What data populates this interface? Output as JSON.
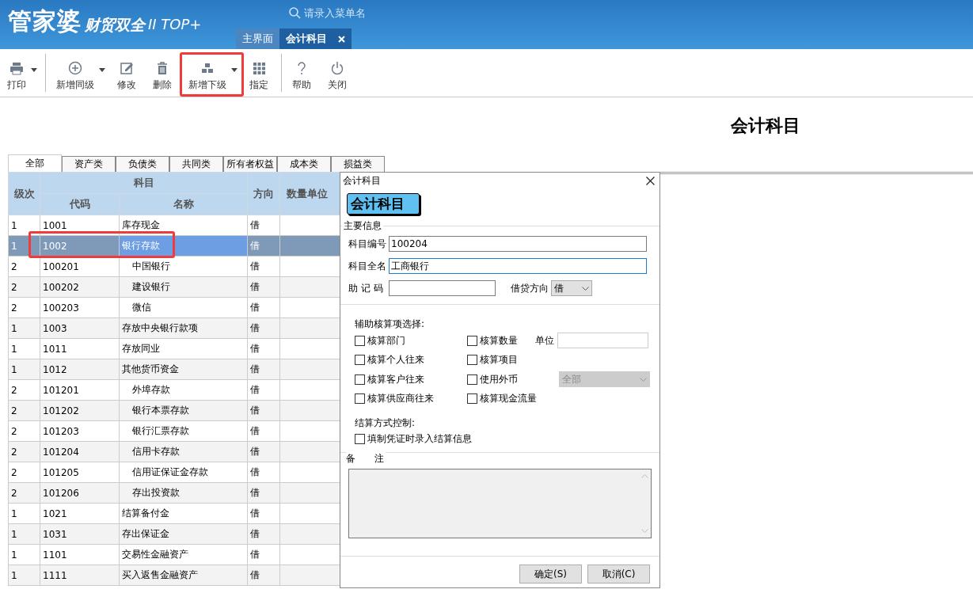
{
  "app": {
    "logo": "管家婆",
    "product": "财贸双全",
    "edition": "II TOP+"
  },
  "search": {
    "placeholder": "请录入菜单名"
  },
  "tabs": [
    {
      "label": "主界面",
      "selected": false,
      "closable": false
    },
    {
      "label": "会计科目",
      "selected": true,
      "closable": true
    }
  ],
  "toolbar_groups": [
    [
      {
        "label": "打印",
        "kind": "printer",
        "dropdown": true,
        "highlighted": false
      }
    ],
    [
      {
        "label": "新增同级",
        "kind": "plus",
        "dropdown": true,
        "highlighted": false
      },
      {
        "label": "修改",
        "kind": "edit",
        "dropdown": false,
        "highlighted": false
      },
      {
        "label": "删除",
        "kind": "trash",
        "dropdown": false,
        "highlighted": false
      },
      {
        "label": "新增下级",
        "kind": "hierarchy",
        "dropdown": true,
        "highlighted": true
      },
      {
        "label": "指定",
        "kind": "grid",
        "dropdown": false,
        "highlighted": false
      }
    ],
    [
      {
        "label": "帮助",
        "kind": "help",
        "dropdown": false,
        "highlighted": false
      },
      {
        "label": "关闭",
        "kind": "power",
        "dropdown": false,
        "highlighted": false
      }
    ]
  ],
  "page_title": "会计科目",
  "category_tabs": [
    {
      "label": "全部",
      "selected": true
    },
    {
      "label": "资产类",
      "selected": false
    },
    {
      "label": "负债类",
      "selected": false
    },
    {
      "label": "共同类",
      "selected": false
    },
    {
      "label": "所有者权益",
      "selected": false
    },
    {
      "label": "成本类",
      "selected": false
    },
    {
      "label": "损益类",
      "selected": false
    }
  ],
  "table": {
    "group_header": "科目",
    "columns": [
      "级次",
      "代码",
      "名称",
      "方向",
      "数量单位"
    ],
    "rows": [
      {
        "level": "1",
        "code": "1001",
        "name": "库存现金",
        "direction": "借",
        "selected": false,
        "annotated": false
      },
      {
        "level": "1",
        "code": "1002",
        "name": "银行存款",
        "direction": "借",
        "selected": true,
        "annotated": true,
        "children": [
          {
            "level": "2",
            "code": "100201",
            "name": "中国银行",
            "direction": "借",
            "selected": false,
            "annotated": false
          },
          {
            "level": "2",
            "code": "100202",
            "name": "建设银行",
            "direction": "借",
            "selected": false,
            "annotated": false
          },
          {
            "level": "2",
            "code": "100203",
            "name": "微信",
            "direction": "借",
            "selected": false,
            "annotated": false
          }
        ]
      },
      {
        "level": "1",
        "code": "1003",
        "name": "存放中央银行款项",
        "direction": "借",
        "selected": false,
        "annotated": false
      },
      {
        "level": "1",
        "code": "1011",
        "name": "存放同业",
        "direction": "借",
        "selected": false,
        "annotated": false
      },
      {
        "level": "1",
        "code": "1012",
        "name": "其他货币资金",
        "direction": "借",
        "selected": false,
        "annotated": false,
        "children": [
          {
            "level": "2",
            "code": "101201",
            "name": "外埠存款",
            "direction": "借",
            "selected": false,
            "annotated": false
          },
          {
            "level": "2",
            "code": "101202",
            "name": "银行本票存款",
            "direction": "借",
            "selected": false,
            "annotated": false
          },
          {
            "level": "2",
            "code": "101203",
            "name": "银行汇票存款",
            "direction": "借",
            "selected": false,
            "annotated": false
          },
          {
            "level": "2",
            "code": "101204",
            "name": "信用卡存款",
            "direction": "借",
            "selected": false,
            "annotated": false
          },
          {
            "level": "2",
            "code": "101205",
            "name": "信用证保证金存款",
            "direction": "借",
            "selected": false,
            "annotated": false
          },
          {
            "level": "2",
            "code": "101206",
            "name": "存出投资款",
            "direction": "借",
            "selected": false,
            "annotated": false
          }
        ]
      },
      {
        "level": "1",
        "code": "1021",
        "name": "结算备付金",
        "direction": "借",
        "selected": false,
        "annotated": false
      },
      {
        "level": "1",
        "code": "1031",
        "name": "存出保证金",
        "direction": "借",
        "selected": false,
        "annotated": false
      },
      {
        "level": "1",
        "code": "1101",
        "name": "交易性金融资产",
        "direction": "借",
        "selected": false,
        "annotated": false
      },
      {
        "level": "1",
        "code": "1111",
        "name": "买入返售金融资产",
        "direction": "借",
        "selected": false,
        "annotated": false
      }
    ]
  },
  "dialog": {
    "title": "会计科目",
    "banner": "会计科目",
    "main_section": "主要信息",
    "fields": [
      {
        "label": "科目编号",
        "value": "100204",
        "focused": false
      },
      {
        "label": "科目全名",
        "value": "工商银行",
        "focused": true
      }
    ],
    "mnemonic": {
      "label": "助 记 码"
    },
    "direction": {
      "label": "借贷方向",
      "value": "借"
    },
    "aux_title": "辅助核算项选择:",
    "checkboxes": [
      {
        "label": "核算部门",
        "checked": false
      },
      {
        "label": "核算数量",
        "checked": false
      },
      {
        "label": "核算个人往来",
        "checked": false
      },
      {
        "label": "核算项目",
        "checked": false
      },
      {
        "label": "核算客户往来",
        "checked": false
      },
      {
        "label": "使用外币",
        "checked": false
      },
      {
        "label": "核算供应商往来",
        "checked": false
      },
      {
        "label": "核算现金流量",
        "checked": false
      }
    ],
    "unit": {
      "label": "单位"
    },
    "currency": {
      "value": "全部",
      "disabled": true
    },
    "settlement_title": "结算方式控制:",
    "settlement_checkbox": {
      "label": "填制凭证时录入结算信息",
      "checked": false
    },
    "remarks_label": "备　　注",
    "buttons": [
      "确定(S)",
      "取消(C)"
    ]
  }
}
